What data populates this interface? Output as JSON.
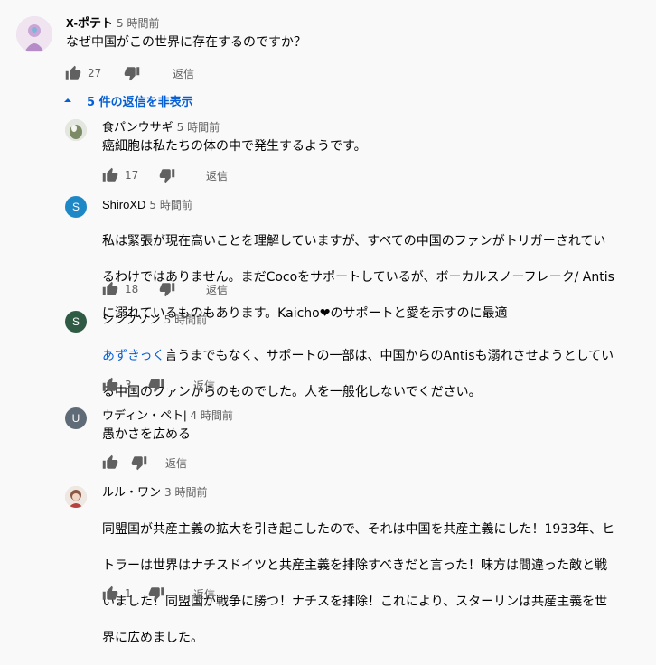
{
  "comments": [
    {
      "author": "X-ポテト",
      "time": "5 時間前",
      "text": "なぜ中国がこの世界に存在するのですか？",
      "likes": "27",
      "reply_label": "返信",
      "avatar": {
        "color": "#e8d6ea",
        "letter": ""
      }
    }
  ],
  "replies_toggle": "5 件の返信を非表示",
  "replies": [
    {
      "author": "食パンウサギ",
      "time": "5 時間前",
      "text": "癌細胞は私たちの体の中で発生するようです。",
      "likes": "17",
      "reply_label": "返信",
      "avatar": {
        "color": "#7b8b66",
        "letter": ""
      }
    },
    {
      "author": "ShiroXD",
      "time": "5 時間前",
      "text": "私は緊張が現在高いことを理解していますが、すべての中国のファンがトリガーされているわけではありません。まだCocoをサポートしているが、ボーカルスノーフレーク/ Antisに溺れているものもあります。Kaicho❤︎のサポートと愛を示すのに最適",
      "text_lines": [
        "私は緊張が現在高いことを理解していますが、すべての中国のファンがトリガーされてい",
        "るわけではありません。まだCocoをサポートしているが、ボーカルスノーフレーク/ Antis",
        "に溺れているものもあります。Kaicho❤︎のサポートと愛を示すのに最適"
      ],
      "likes": "18",
      "reply_label": "返信",
      "avatar": {
        "color": "#1e88c7",
        "letter": "S"
      }
    },
    {
      "author": "シンプソン",
      "time": "5 時間前",
      "mention": "あずきっく",
      "text_lines": [
        "言うまでもなく、サポートの一部は、中国からのAntisも溺れさせようとしてい",
        "る中国のファンからのものでした。人を一般化しないでください。"
      ],
      "likes": "3",
      "reply_label": "返信",
      "avatar": {
        "color": "#2f5b44",
        "letter": "S"
      }
    },
    {
      "author": "ウディン・ペト|",
      "time": "4 時間前",
      "text": "愚かさを広める",
      "likes": "",
      "reply_label": "返信",
      "avatar": {
        "color": "#5f6b76",
        "letter": "U"
      }
    },
    {
      "author": "ルル・ワン",
      "time": "3 時間前",
      "text_lines": [
        "同盟国が共産主義の拡大を引き起こしたので、それは中国を共産主義にした！1933年、ヒ",
        "トラーは世界はナチスドイツと共産主義を排除すべきだと言った！味方は間違った敵と戦",
        "いました！同盟国が戦争に勝つ！ナチスを排除！これにより、スターリンは共産主義を世",
        "界に広めました。"
      ],
      "likes": "1",
      "reply_label": "返信",
      "avatar": {
        "color": "#d9cfc8",
        "letter": ""
      }
    }
  ],
  "icons": {
    "like": "thumb-up-icon",
    "dislike": "thumb-down-icon",
    "collapse": "chevron-up-icon"
  }
}
